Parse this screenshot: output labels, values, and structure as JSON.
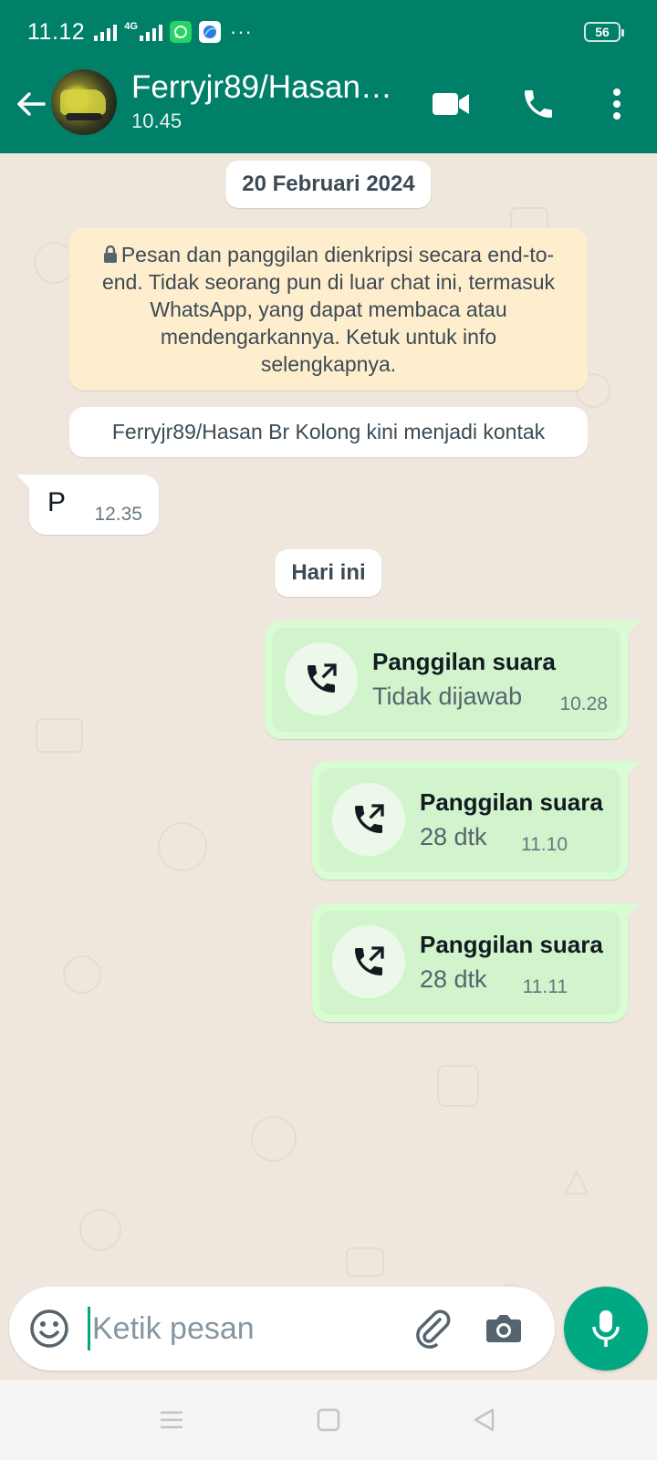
{
  "status_bar": {
    "time": "11.12",
    "network": "4G",
    "battery": "56"
  },
  "header": {
    "contact_name": "Ferryjr89/Hasan…",
    "last_seen": "10.45"
  },
  "chat": {
    "date_chip_1": "20 Februari 2024",
    "encryption_notice": "Pesan dan panggilan dienkripsi secara end-to-end. Tidak seorang pun di luar chat ini, termasuk WhatsApp, yang dapat membaca atau mendengarkannya. Ketuk untuk info selengkapnya.",
    "contact_note": "Ferryjr89/Hasan Br Kolong kini menjadi kontak",
    "incoming_message": {
      "text": "P",
      "time": "12.35"
    },
    "date_chip_2": "Hari ini",
    "calls": [
      {
        "title": "Panggilan suara",
        "subtitle": "Tidak dijawab",
        "time": "10.28"
      },
      {
        "title": "Panggilan suara",
        "subtitle": "28 dtk",
        "time": "11.10"
      },
      {
        "title": "Panggilan suara",
        "subtitle": "28 dtk",
        "time": "11.11"
      }
    ]
  },
  "composer": {
    "placeholder": "Ketik pesan"
  },
  "colors": {
    "header": "#008069",
    "accent": "#00a884",
    "outgoing_bubble": "#d9fdd3",
    "chat_background": "#efe7de",
    "system_notice": "#ffeecd"
  },
  "icons": {
    "back": "arrow-left-icon",
    "video": "video-camera-icon",
    "voice_call": "phone-icon",
    "menu": "more-vertical-icon",
    "lock": "lock-icon",
    "outgoing_call": "outgoing-call-icon",
    "emoji": "emoji-icon",
    "attach": "paperclip-icon",
    "camera": "camera-icon",
    "mic": "microphone-icon"
  }
}
